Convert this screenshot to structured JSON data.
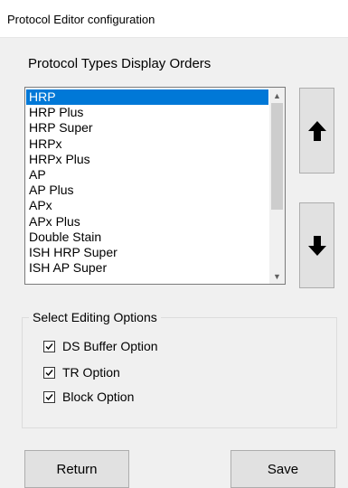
{
  "window": {
    "title": "Protocol Editor configuration"
  },
  "protocol_types": {
    "label": "Protocol Types Display Orders",
    "selected_index": 0,
    "items": [
      "HRP",
      "HRP Plus",
      "HRP Super",
      "HRPx",
      "HRPx Plus",
      "AP",
      "AP Plus",
      "APx",
      "APx Plus",
      "Double Stain",
      "ISH HRP Super",
      "ISH AP Super"
    ]
  },
  "editing_options": {
    "legend": "Select Editing Options",
    "options": [
      {
        "label": "DS Buffer Option",
        "checked": true
      },
      {
        "label": "TR Option",
        "checked": true
      },
      {
        "label": "Block Option",
        "checked": true
      }
    ]
  },
  "buttons": {
    "return_label": "Return",
    "save_label": "Save",
    "move_up_icon": "arrow-up-icon",
    "move_down_icon": "arrow-down-icon"
  },
  "colors": {
    "selection": "#0078d7",
    "window_bg": "#f0f0f0",
    "button_bg": "#e1e1e1"
  }
}
